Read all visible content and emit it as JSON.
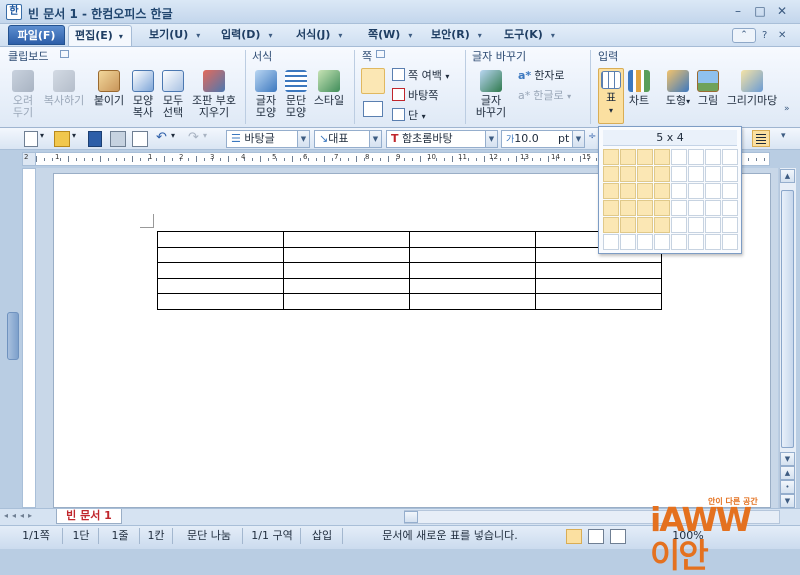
{
  "window": {
    "title": "빈 문서 1 - 한컴오피스 한글",
    "minimize": "–",
    "maximize": "□",
    "close": "✕"
  },
  "menu": {
    "file": "파일(F)",
    "edit": "편집(E)",
    "items": [
      "보기(U)",
      "입력(D)",
      "서식(J)",
      "쪽(W)",
      "보안(R)",
      "도구(K)"
    ],
    "help": "?"
  },
  "ribbon": {
    "groups": {
      "clipboard": "클립보드",
      "format": "서식",
      "page": "쪽",
      "replace": "글자 바꾸기",
      "insert": "입력"
    },
    "clipboard": [
      {
        "label": "오려\n두기",
        "disabled": true
      },
      {
        "label": "복사하기",
        "disabled": true
      },
      {
        "label": "붙이기",
        "disabled": false
      },
      {
        "label": "모양\n복사",
        "disabled": false
      },
      {
        "label": "모두\n선택",
        "disabled": false
      },
      {
        "label": "조판 부호\n지우기",
        "disabled": false
      }
    ],
    "format": [
      {
        "label": "글자\n모양"
      },
      {
        "label": "문단\n모양"
      },
      {
        "label": "스타일"
      }
    ],
    "page": {
      "margin": "쪽 여백",
      "background": "바탕쪽",
      "columns": "단"
    },
    "replace": {
      "change_case": "글자\n바꾸기",
      "hanja": "한자로",
      "hangul": "한글로"
    },
    "insert": [
      {
        "label": "표"
      },
      {
        "label": "차트"
      },
      {
        "label": "도형"
      },
      {
        "label": "그림"
      },
      {
        "label": "그리기마당"
      }
    ]
  },
  "toolbar": {
    "style": "바탕글",
    "lang": "대표",
    "font": "함초롬바탕",
    "size": "10.0",
    "unit": "pt"
  },
  "ruler_marks": [
    "2",
    "1",
    "1",
    "2",
    "3",
    "4",
    "5",
    "6",
    "7",
    "8",
    "9",
    "10",
    "11",
    "12",
    "13",
    "14",
    "15",
    "16",
    "17",
    "18"
  ],
  "table_picker": {
    "label": "5 x 4",
    "cols": 8,
    "rows": 6,
    "sel_cols": 4,
    "sel_rows": 5
  },
  "document": {
    "tab": "빈 문서 1",
    "table_rows": 5,
    "table_cols": 4
  },
  "status": {
    "page": "1/1쪽",
    "column": "1단",
    "line": "1줄",
    "col": "1칸",
    "break": "문단 나눔",
    "section": "1/1 구역",
    "mode": "삽입",
    "message": "문서에 새로운 표를 넣습니다.",
    "zoom": "100%"
  },
  "logo": {
    "main": "iAWW 이안",
    "tagline": "안이 다른 공간"
  },
  "colors": {
    "accent": "#2d5ea8",
    "selection": "#fbe7b4",
    "logo": "#e4711f"
  }
}
